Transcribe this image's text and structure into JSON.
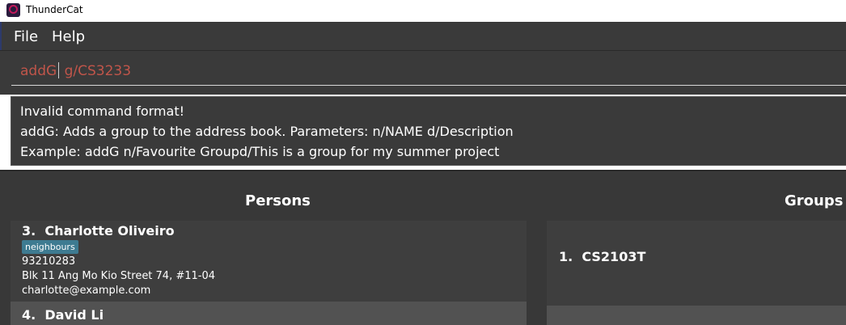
{
  "window": {
    "title": "ThunderCat"
  },
  "menu": {
    "file": "File",
    "help": "Help"
  },
  "command": {
    "value_before_caret": "addG",
    "value_after_caret": " g/CS3233"
  },
  "result": {
    "lines": [
      "Invalid command format!",
      "addG: Adds a group to the address book. Parameters: n/NAME d/Description",
      "Example: addG n/Favourite Groupd/This is a group for my summer project"
    ]
  },
  "persons": {
    "title": "Persons",
    "items": [
      {
        "index": "3.",
        "name": "Charlotte Oliveiro",
        "tag": "neighbours",
        "phone": "93210283",
        "address": "Blk 11 Ang Mo Kio Street 74, #11-04",
        "email": "charlotte@example.com"
      },
      {
        "index": "4.",
        "name": "David Li"
      }
    ]
  },
  "groups": {
    "title": "Groups",
    "items": [
      {
        "index": "1.",
        "name": "CS2103T"
      }
    ]
  },
  "colors": {
    "background": "#383838",
    "command_error_text": "#c0554a",
    "tag": "#3e7b91"
  }
}
